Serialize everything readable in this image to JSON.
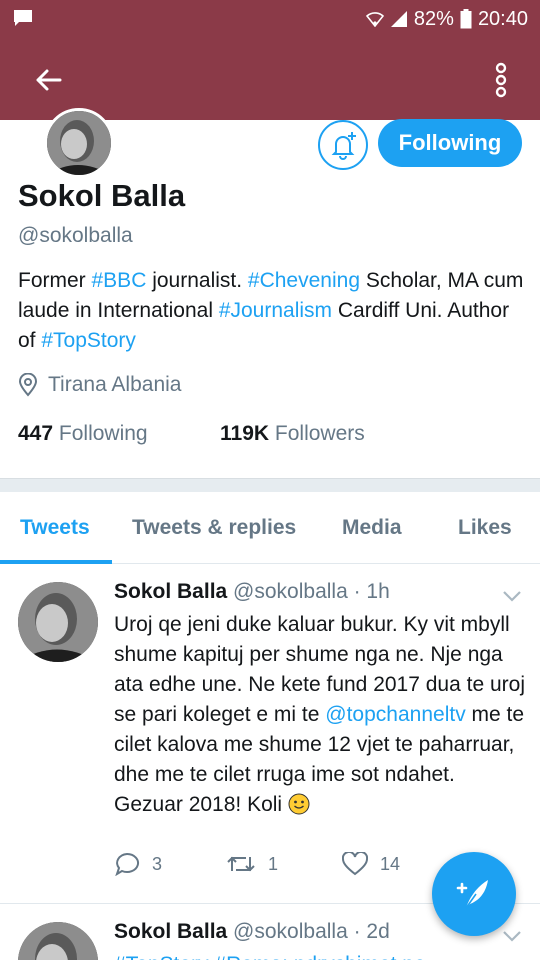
{
  "status_bar": {
    "battery": "82%",
    "time": "20:40"
  },
  "profile": {
    "name": "Sokol Balla",
    "handle": "@sokolballa",
    "follow_label": "Following",
    "bio": {
      "p1": "Former ",
      "tag1": "#BBC",
      "p2": " journalist. ",
      "tag2": "#Chevening",
      "p3": " Scholar, MA cum laude in International ",
      "tag3": "#Journalism",
      "p4": " Cardiff Uni. Author of ",
      "tag4": "#TopStory"
    },
    "location": "Tirana Albania",
    "following_count": "447",
    "following_label": "Following",
    "followers_count": "119K",
    "followers_label": "Followers"
  },
  "tabs": [
    {
      "label": "Tweets",
      "active": true
    },
    {
      "label": "Tweets & replies",
      "active": false
    },
    {
      "label": "Media",
      "active": false
    },
    {
      "label": "Likes",
      "active": false
    }
  ],
  "tweets": [
    {
      "name": "Sokol Balla",
      "meta": "@sokolballa · 1h",
      "text_before": "Uroj qe jeni duke kaluar bukur. Ky vit mbyll shume kapituj per shume nga ne. Nje nga ata edhe une. Ne kete fund 2017 dua te uroj se pari koleget e mi te ",
      "mention": "@topchanneltv",
      "text_after": " me te cilet kalova me shume 12 vjet te paharruar, dhe me te cilet rruga ime sot ndahet. Gezuar 2018! Koli ",
      "replies": "3",
      "retweets": "1",
      "likes": "14"
    },
    {
      "name": "Sokol Balla",
      "meta": "@sokolballa · 2d",
      "text_partial": "#TopStory #Roma: ndryshimet ne"
    }
  ],
  "colors": {
    "app_bar": "#8b3a48",
    "accent": "#1da1f2",
    "secondary_text": "#657786"
  }
}
